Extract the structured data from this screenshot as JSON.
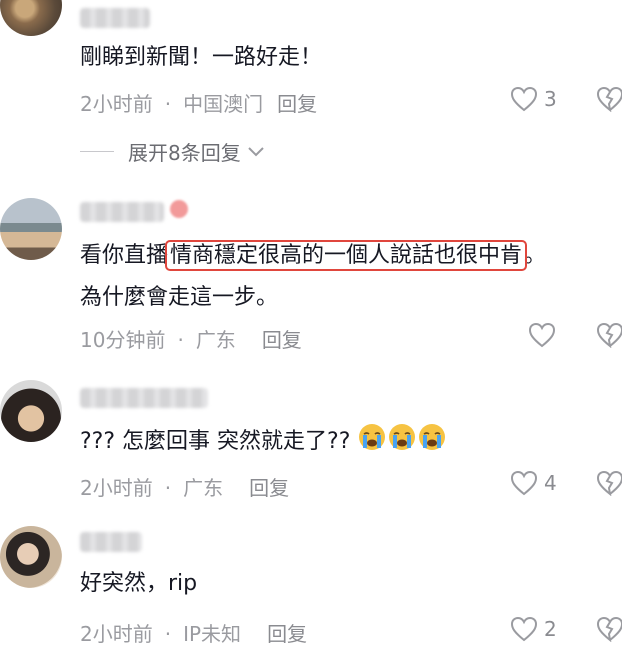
{
  "comments": [
    {
      "text_lines": [
        "剛睇到新聞！一路好走！"
      ],
      "time": "2小时前",
      "location": "中国澳门",
      "reply_label": "回复",
      "likes": "3"
    },
    {
      "text_prefix": "看你直播",
      "text_highlight": "情商穩定很高的一個人說話也很中肯",
      "text_suffix": "。",
      "text_line2": "為什麼會走這一步。",
      "time": "10分钟前",
      "location": "广东",
      "reply_label": "回复",
      "likes": ""
    },
    {
      "text_lines": [
        "??? 怎麼回事 突然就走了??"
      ],
      "time": "2小时前",
      "location": "广东",
      "reply_label": "回复",
      "likes": "4"
    },
    {
      "text_lines": [
        "好突然，rip"
      ],
      "time": "2小时前",
      "location": "IP未知",
      "reply_label": "回复",
      "likes": "2"
    }
  ],
  "expand_replies": "展开8条回复",
  "colors": {
    "highlight_border": "#e0463d",
    "meta_text": "#9a9ba0",
    "body_text": "#161823"
  },
  "icons": [
    "heart-icon",
    "broken-heart-icon",
    "chevron-down-icon",
    "crying-emoji"
  ]
}
